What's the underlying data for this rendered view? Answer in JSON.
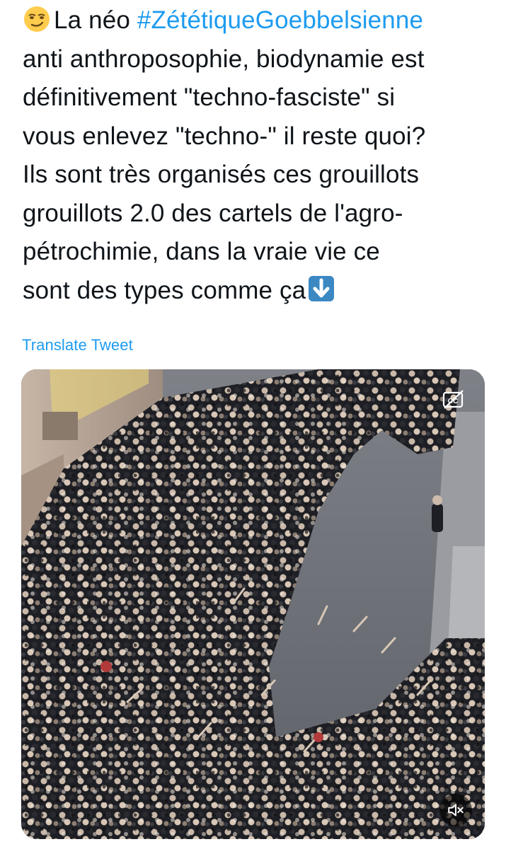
{
  "tweet": {
    "emoji": "smirking-face",
    "text_prefix": "La néo ",
    "hashtag": "#ZététiqueGoebbelsienne",
    "lines": [
      "anti anthroposophie, biodynamie est",
      "définitivement \"techno-fasciste\" si",
      "vous enlevez \"techno-\" il reste quoi?",
      "Ils sont très organisés ces grouillots",
      "grouillots 2.0 des cartels de l'agro-",
      "pétrochimie, dans la vraie vie ce"
    ],
    "last_line": "sont des types comme ça",
    "end_emoji": "down-arrow-emoji",
    "translate_label": "Translate Tweet"
  },
  "media": {
    "type": "video",
    "cc_icon": "closed-captions-off-icon",
    "mute_icon": "speaker-muted-icon"
  },
  "colors": {
    "text": "#0f1419",
    "link": "#1d9bf0",
    "background": "#ffffff"
  }
}
